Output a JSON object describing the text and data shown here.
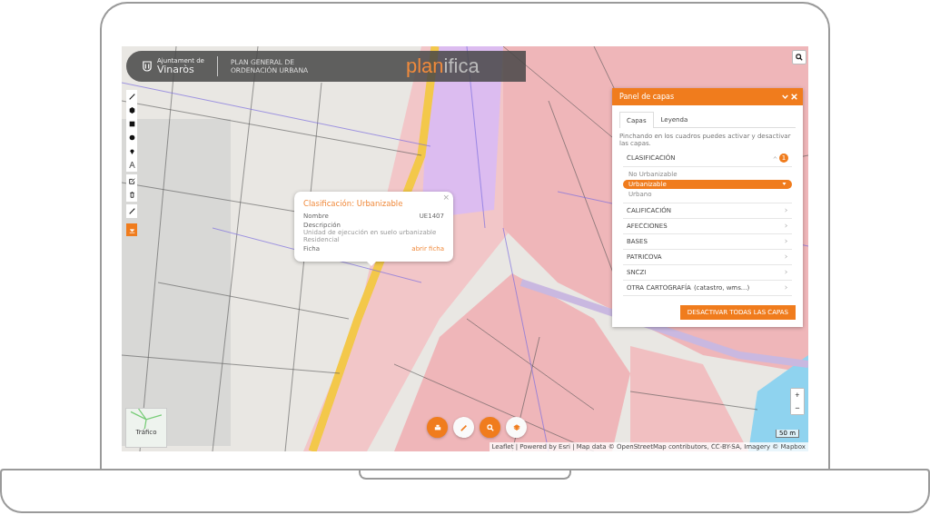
{
  "header": {
    "municipality_small": "Ajuntament de",
    "municipality": "Vinaròs",
    "title_line_1": "PLAN GENERAL DE",
    "title_line_2": "ORDENACIÓN URBANA",
    "brand_part_1": "plan",
    "brand_part_2": "ifica"
  },
  "popup": {
    "close": "×",
    "title": "Clasificación: Urbanizable",
    "fields": [
      {
        "label": "Nombre",
        "value": "UE1407"
      },
      {
        "label": "Descripción",
        "text": "Unidad de ejecución en suelo urbanizable Residencial"
      },
      {
        "label": "Ficha",
        "link": "abrir ficha"
      }
    ]
  },
  "panel": {
    "title": "Panel de capas",
    "tabs": [
      {
        "label": "Capas",
        "selected": true
      },
      {
        "label": "Leyenda",
        "selected": false
      }
    ],
    "hint": "Pinchando en los cuadros puedes activar y desactivar las capas.",
    "sections": [
      {
        "label": "CLASIFICACIÓN",
        "expanded": true,
        "badge": "1",
        "items": [
          {
            "label": "No Urbanizable",
            "selected": false
          },
          {
            "label": "Urbanizable",
            "selected": true
          },
          {
            "label": "Urbano",
            "selected": false
          }
        ]
      },
      {
        "label": "CALIFICACIÓN",
        "expanded": false
      },
      {
        "label": "AFECCIONES",
        "expanded": false
      },
      {
        "label": "BASES",
        "expanded": false
      },
      {
        "label": "PATRICOVA",
        "expanded": false
      },
      {
        "label": "SNCZI",
        "expanded": false
      },
      {
        "label": "OTRA CARTOGRAFÍA",
        "note": "(catastro, wms...)",
        "expanded": false
      }
    ],
    "button": "DESACTIVAR TODAS LAS CAPAS"
  },
  "layer_switcher": {
    "label": "Tráfico"
  },
  "zoom": [
    "+",
    "−"
  ],
  "scale": "50 m",
  "attribution": "Leaflet | Powered by Esri | Map data © OpenStreetMap contributors, CC-BY-SA, Imagery © Mapbox"
}
